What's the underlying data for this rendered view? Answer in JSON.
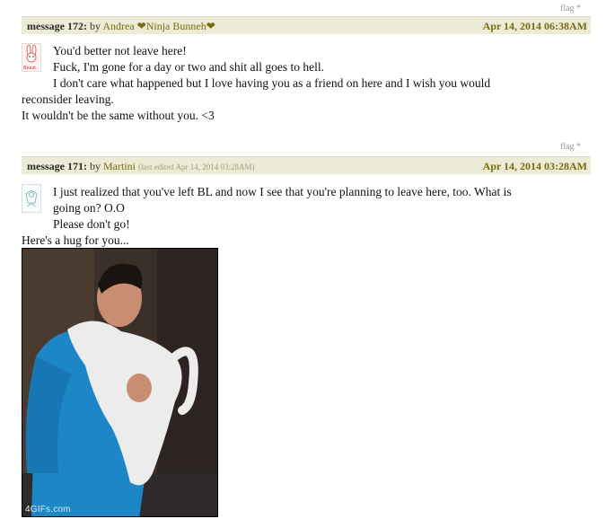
{
  "messages": [
    {
      "flag_label": "flag",
      "flag_mark": "*",
      "number": "message 172:",
      "by": "by",
      "author": "Andrea ❤Ninja Bunneh❤",
      "edited": "",
      "date": "Apr 14, 2014 06:38AM",
      "avatar_icon": "bunny-avatar-icon",
      "avatar_caption": "Beast.",
      "lines": [
        "You'd better not leave here!",
        "Fuck, I'm gone for a day or two and shit all goes to hell.",
        "I don't care what happened but I love having you as a friend on here and I wish you would",
        "reconsider leaving.",
        "It wouldn't be the same without you. <3"
      ]
    },
    {
      "flag_label": "flag",
      "flag_mark": "*",
      "number": "message 171:",
      "by": "by",
      "author": "Martini",
      "edited": "(last edited Apr 14, 2014 03:28AM)",
      "date": "Apr 14, 2014 03:28AM",
      "avatar_icon": "user-avatar-icon",
      "lines": [
        "I just realized that you've left BL and now I see that you're planning to leave here, too. What is",
        "going on? O.O",
        "Please don't go!",
        "Here's a hug for you..."
      ],
      "image_watermark": "4GIFs.com"
    }
  ]
}
